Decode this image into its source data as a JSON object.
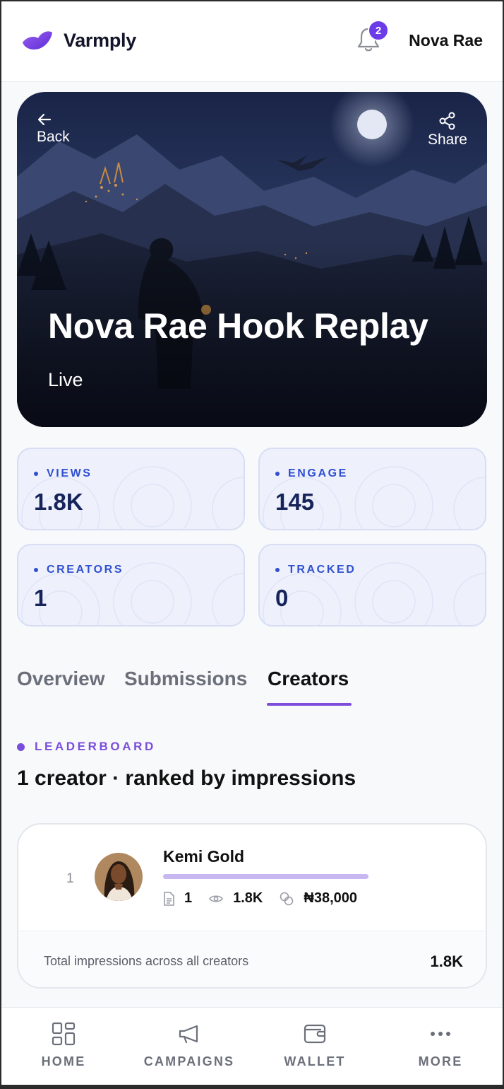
{
  "header": {
    "brand": "Varmply",
    "notification_count": "2",
    "user_name": "Nova Rae"
  },
  "hero": {
    "back_label": "Back",
    "share_label": "Share",
    "title": "Nova Rae Hook Replay",
    "status": "Live"
  },
  "stats": [
    {
      "label": "VIEWS",
      "value": "1.8K"
    },
    {
      "label": "ENGAGE",
      "value": "145"
    },
    {
      "label": "CREATORS",
      "value": "1"
    },
    {
      "label": "TRACKED",
      "value": "0"
    }
  ],
  "tabs": [
    {
      "label": "Overview",
      "active": false
    },
    {
      "label": "Submissions",
      "active": false
    },
    {
      "label": "Creators",
      "active": true
    }
  ],
  "leaderboard": {
    "section_label": "LEADERBOARD",
    "heading": "1 creator · ranked by impressions",
    "creators": [
      {
        "rank": "1",
        "name": "Kemi Gold",
        "submissions": "1",
        "impressions": "1.8K",
        "earnings": "₦38,000"
      }
    ],
    "footer_label": "Total impressions across all creators",
    "footer_value": "1.8K"
  },
  "nav": [
    {
      "label": "HOME",
      "icon": "grid-icon"
    },
    {
      "label": "CAMPAIGNS",
      "icon": "megaphone-icon"
    },
    {
      "label": "WALLET",
      "icon": "wallet-icon"
    },
    {
      "label": "MORE",
      "icon": "more-dots-icon"
    }
  ],
  "colors": {
    "accent": "#7c4ddc",
    "stat_text": "#2f4fd0",
    "stat_bg": "#eef1fc"
  }
}
